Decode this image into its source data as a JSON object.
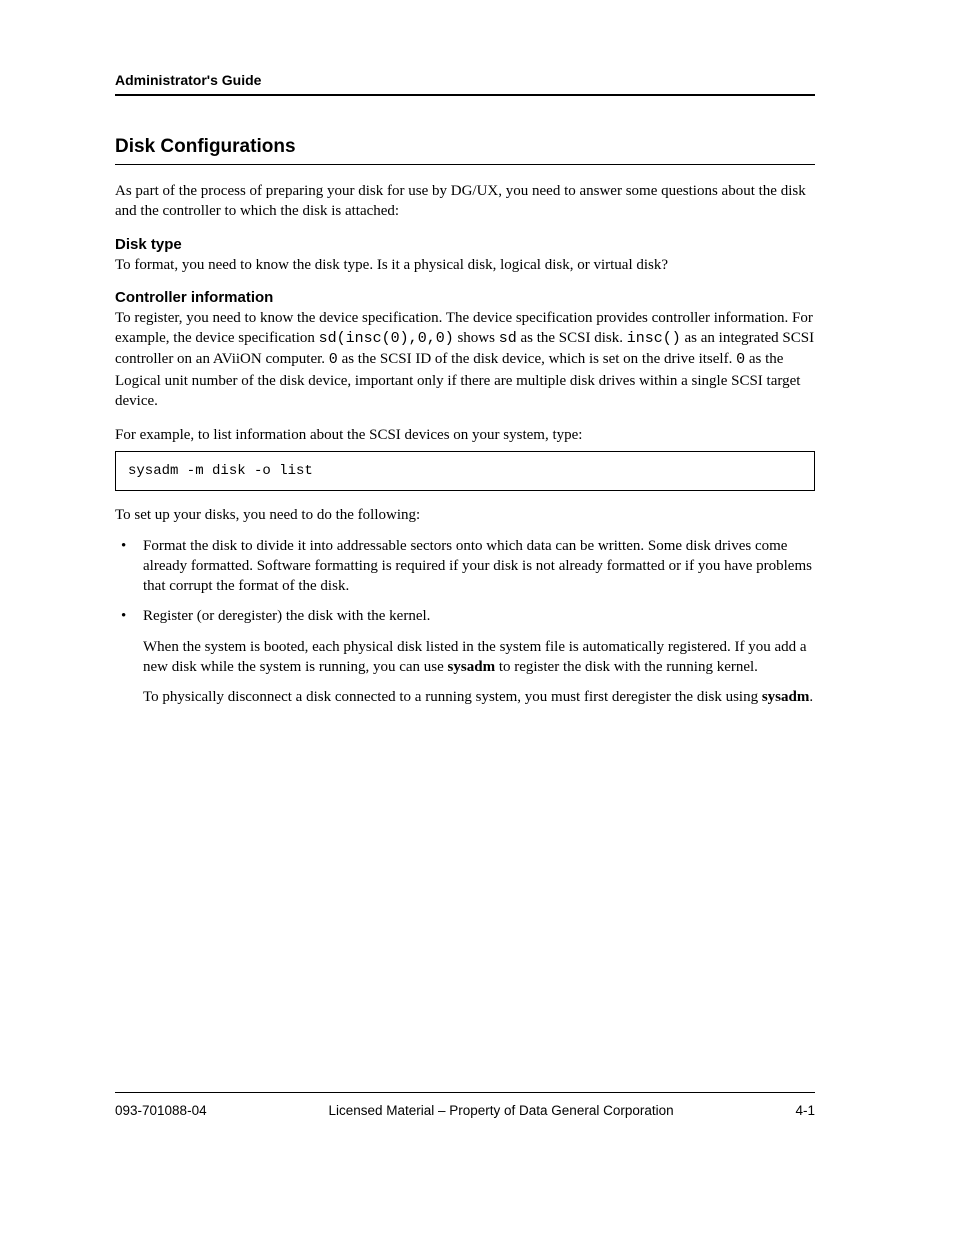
{
  "header": {
    "title": "Administrator's Guide"
  },
  "section": {
    "heading": "Disk Configurations",
    "intro": "As part of the process of preparing your disk for use by DG/UX, you need to answer some questions about the disk and the controller to which the disk is attached:",
    "terms": [
      {
        "term": "Disk type",
        "defn": "To format, you need to know the disk type. Is it a physical disk, logical disk, or virtual disk?"
      },
      {
        "term": "Controller information",
        "defn_pre": "To register, you need to know the device specification. The device specification provides controller information. For example, the device specification ",
        "defn_code": "sd(insc(0),0,0)",
        "defn_post": " shows "
      }
    ],
    "controller_items": [
      {
        "code": "sd",
        "text": " as the SCSI disk."
      },
      {
        "code": "insc()",
        "text": " as an integrated SCSI controller on an AViiON computer."
      },
      {
        "code": "0",
        "text": " as the SCSI ID of the disk device, which is set on the drive itself."
      },
      {
        "code": "0",
        "text": " as the Logical unit number of the disk device, important only if there are multiple disk drives within a single SCSI target device."
      }
    ],
    "example_text": "For example, to list information about the SCSI devices on your system, type:",
    "code_box": "sysadm -m disk -o list",
    "bullets_intro": "To set up your disks, you need to do the following:",
    "bullets": [
      "Format the disk to divide it into addressable sectors onto which data can be written. Some disk drives come already formatted. Software formatting is required if your disk is not already formatted or if you have problems that corrupt the format of the disk.",
      "Register (or deregister) the disk with the kernel."
    ],
    "bullets_post": [
      {
        "pre": "When the system is booted, each physical disk listed in the system file is automatically registered. If you add a new disk while the system is running, you can use ",
        "bold": "sysadm",
        "post": " to register the disk with the running kernel."
      },
      {
        "pre": "To physically disconnect a disk connected to a running system, you must first deregister the disk using ",
        "bold": "sysadm",
        "post": "."
      }
    ]
  },
  "footer": {
    "ref": "093-701088-04",
    "company": "Licensed Material – Property of Data General Corporation",
    "page": "4-1"
  }
}
